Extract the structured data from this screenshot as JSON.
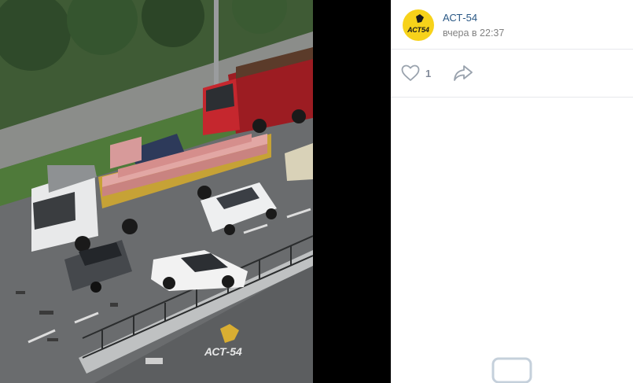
{
  "post": {
    "author": "АСТ-54",
    "time": "вчера в 22:37",
    "avatar_text": "АСТ54",
    "likes": "1"
  },
  "photo": {
    "watermark": "АСТ-54"
  },
  "icons": {
    "like": "heart-icon",
    "share": "share-arrow-icon",
    "comments": "comment-bubble-icon"
  },
  "colors": {
    "link": "#2a5885",
    "muted": "#828282",
    "avatar_bg": "#f7d21a",
    "divider": "#e7e8ec"
  }
}
